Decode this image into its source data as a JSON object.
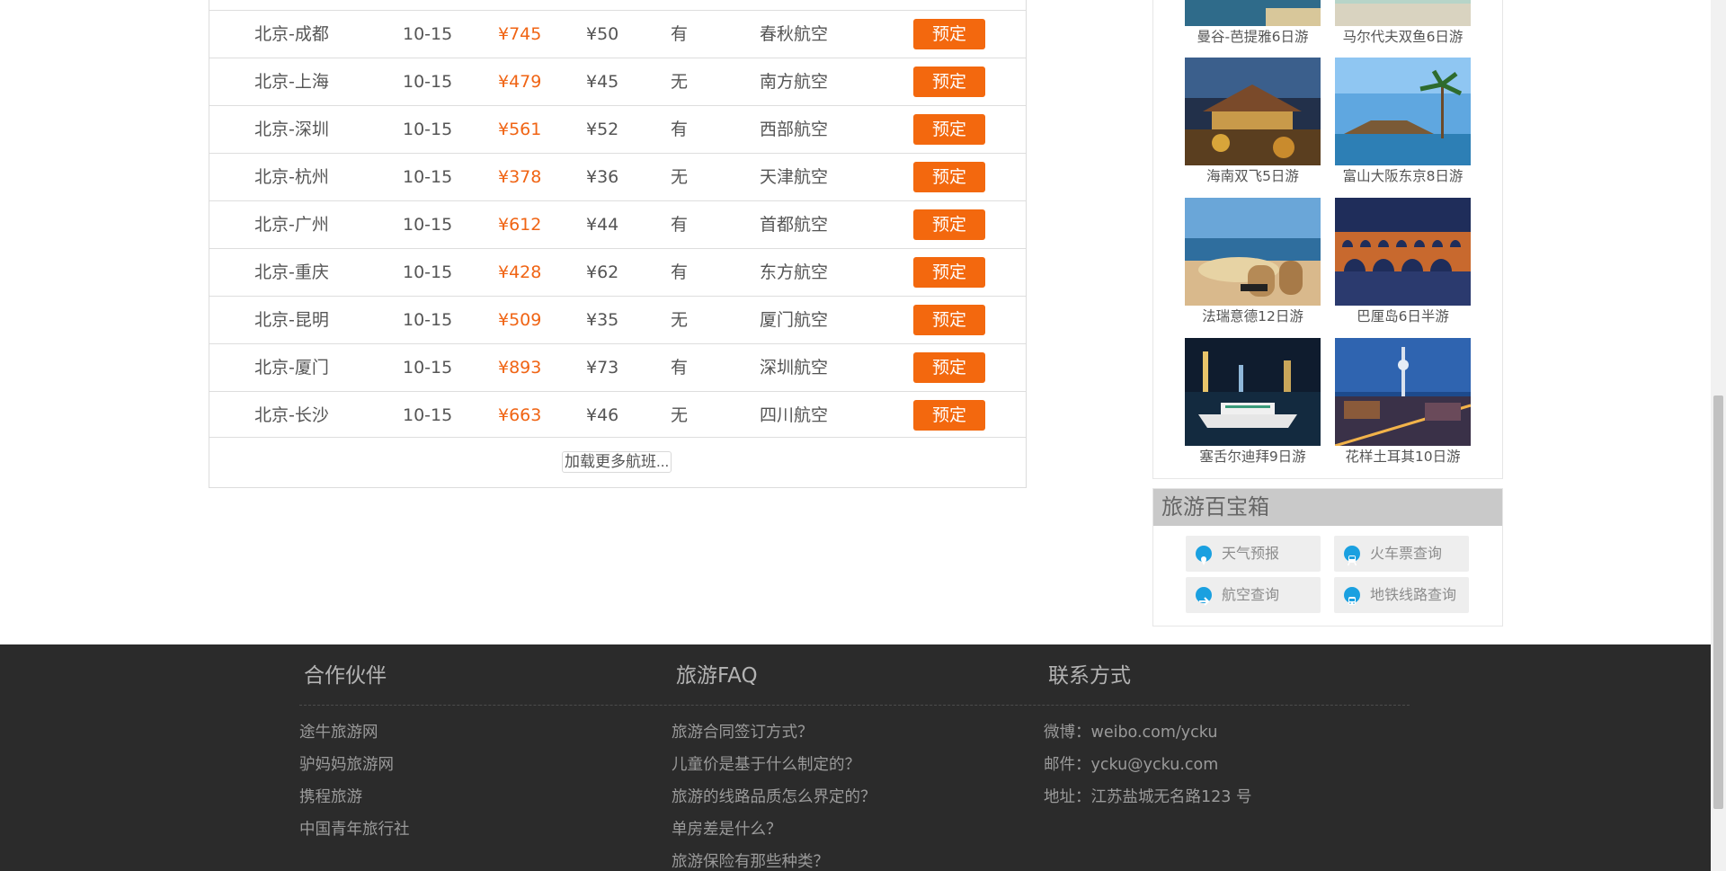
{
  "flights": [
    {
      "route": "北京-成都",
      "date": "10-15",
      "price": "¥745",
      "tax": "¥50",
      "meal": "有",
      "airline": "春秋航空",
      "book_label": "预定"
    },
    {
      "route": "北京-上海",
      "date": "10-15",
      "price": "¥479",
      "tax": "¥45",
      "meal": "无",
      "airline": "南方航空",
      "book_label": "预定"
    },
    {
      "route": "北京-深圳",
      "date": "10-15",
      "price": "¥561",
      "tax": "¥52",
      "meal": "有",
      "airline": "西部航空",
      "book_label": "预定"
    },
    {
      "route": "北京-杭州",
      "date": "10-15",
      "price": "¥378",
      "tax": "¥36",
      "meal": "无",
      "airline": "天津航空",
      "book_label": "预定"
    },
    {
      "route": "北京-广州",
      "date": "10-15",
      "price": "¥612",
      "tax": "¥44",
      "meal": "有",
      "airline": "首都航空",
      "book_label": "预定"
    },
    {
      "route": "北京-重庆",
      "date": "10-15",
      "price": "¥428",
      "tax": "¥62",
      "meal": "有",
      "airline": "东方航空",
      "book_label": "预定"
    },
    {
      "route": "北京-昆明",
      "date": "10-15",
      "price": "¥509",
      "tax": "¥35",
      "meal": "无",
      "airline": "厦门航空",
      "book_label": "预定"
    },
    {
      "route": "北京-厦门",
      "date": "10-15",
      "price": "¥893",
      "tax": "¥73",
      "meal": "有",
      "airline": "深圳航空",
      "book_label": "预定"
    },
    {
      "route": "北京-长沙",
      "date": "10-15",
      "price": "¥663",
      "tax": "¥46",
      "meal": "无",
      "airline": "四川航空",
      "book_label": "预定"
    }
  ],
  "load_more_label": "加载更多航班...",
  "tours": [
    {
      "caption": "曼谷-芭提雅6日游"
    },
    {
      "caption": "马尔代夫双鱼6日游"
    },
    {
      "caption": "海南双飞5日游"
    },
    {
      "caption": "富山大阪东京8日游"
    },
    {
      "caption": "法瑞意德12日游"
    },
    {
      "caption": "巴厘岛6日半游"
    },
    {
      "caption": "塞舌尔迪拜9日游"
    },
    {
      "caption": "花样土耳其10日游"
    }
  ],
  "toolbox": {
    "title": "旅游百宝箱",
    "tools": [
      {
        "label": "天气预报",
        "icon": "location-pin-icon"
      },
      {
        "label": "火车票查询",
        "icon": "train-icon"
      },
      {
        "label": "航空查询",
        "icon": "airplane-icon"
      },
      {
        "label": "地铁线路查询",
        "icon": "subway-icon"
      }
    ]
  },
  "footer": {
    "partners": {
      "title": "合作伙伴",
      "links": [
        "途牛旅游网",
        "驴妈妈旅游网",
        "携程旅游",
        "中国青年旅行社"
      ]
    },
    "faq": {
      "title": "旅游FAQ",
      "links": [
        "旅游合同签订方式？",
        "儿童价是基于什么制定的？",
        "旅游的线路品质怎么界定的？",
        "单房差是什么？",
        "旅游保险有那些种类？"
      ]
    },
    "contact": {
      "title": "联系方式",
      "items": [
        "微博：weibo.com/ycku",
        "邮件：ycku@ycku.com",
        "地址：江苏盐城无名路123 号"
      ]
    }
  },
  "colors": {
    "accent": "#f3680e",
    "price": "#f06414",
    "footer_bg": "#2b2b2b",
    "tool_icon": "#1aa0e0"
  }
}
